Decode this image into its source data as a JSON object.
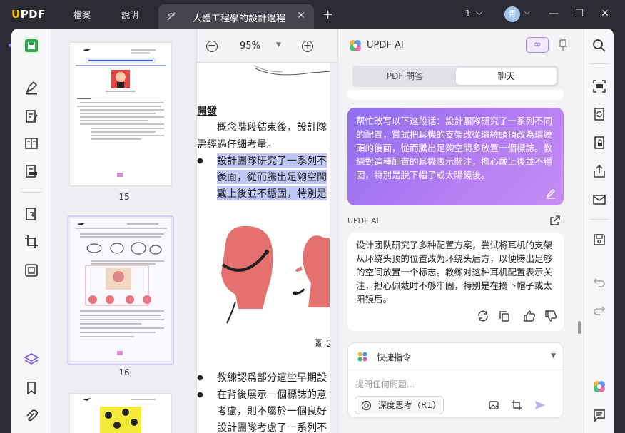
{
  "app": {
    "logo": "UPDF",
    "menu": [
      {
        "label": "檔案"
      },
      {
        "label": "說明"
      }
    ],
    "tab_title": "人體工程學的設計過程",
    "page_indicator": "1",
    "avatar_initial": "青"
  },
  "thumbnails": {
    "pages": [
      {
        "label": "15"
      },
      {
        "label": "16"
      }
    ]
  },
  "document": {
    "zoom": "95%",
    "lines": [
      "開發",
      "概念階段結束後，設計隊",
      "需經過仔細考量。",
      "設計團隊研究了一系列不",
      "後面，從而騰出足夠空間",
      "戴上後並不穩固，特別是",
      "圖 2",
      "教練認爲部分這些早期設",
      "在背後展示一個標誌的意",
      "考慮，則不屬於一個良好",
      "設計團隊考慮了一系列不"
    ]
  },
  "ai": {
    "title": "UPDF AI",
    "mode_icon": "∞",
    "tabs": [
      {
        "label": "PDF 問答",
        "active": false
      },
      {
        "label": "聊天",
        "active": true
      }
    ],
    "user_message": "帮忙改写以下这段话：設計團隊研究了一系列不同的配置，嘗試把耳機的支架改從環繞頭頂改為環繞頭的後面，從而騰出足夠空間多放置一個標誌。教練對這種配置的耳機表示關注，擔心戴上後並不穩固，特別是脫下帽子或太陽鏡後。",
    "response_label": "UPDF AI",
    "response_message": "设计团队研究了多种配置方案，尝试将耳机的支架从环绕头顶的位置改为环绕头后方，以便腾出足够的空间放置一个标志。教练对这种耳机配置表示关注，担心佩戴时不够牢固，特别是在摘下帽子或太阳镜后。",
    "quick_commands_label": "快捷指令",
    "input_placeholder": "提問任何問題...",
    "deep_think_label": "深度思考（R1）"
  },
  "colors": {
    "accent_green": "#2fa84f",
    "accent_purple": "#8e6ef0",
    "logo_yellow": "#ffb200"
  }
}
